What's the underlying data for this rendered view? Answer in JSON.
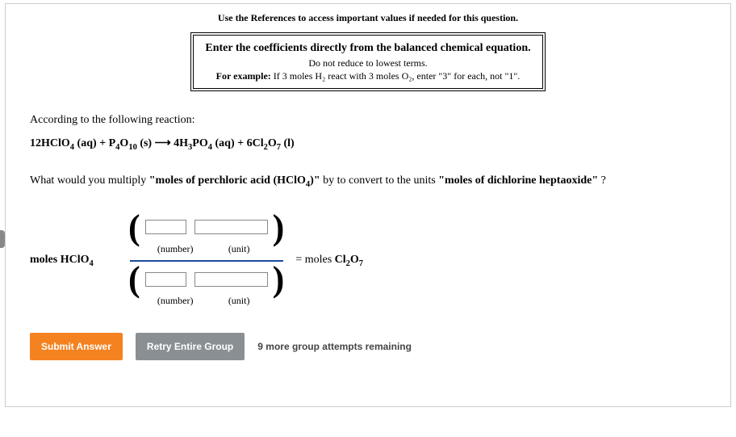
{
  "header": {
    "references_note": "Use the References to access important values if needed for this question."
  },
  "hint": {
    "line1": "Enter the coefficients directly from the balanced chemical equation.",
    "line2": "Do not reduce to lowest terms.",
    "line3_prefix": "For example:",
    "line3_rest": " If 3 moles H₂ react with 3 moles O₂, enter \"3\" for each, not \"1\"."
  },
  "intro": "According to the following reaction:",
  "equation_html": "12HClO₄ (aq) + P₄O₁₀ (s) ⟶ 4H₃PO₄ (aq) + 6Cl₂O₇ (l)",
  "question": {
    "pre": "What would you multiply ",
    "bold1": "\"moles of perchloric acid (HClO₄)\"",
    "mid": " by to convert to the units ",
    "bold2": "\"moles of dichlorine heptaoxide\"",
    "post": " ?"
  },
  "frac": {
    "lhs": "moles HClO₄",
    "rhs_prefix": "= moles ",
    "rhs_formula": "Cl₂O₇",
    "number_label": "(number)",
    "unit_label": "(unit)",
    "top": {
      "number": "",
      "unit": ""
    },
    "bottom": {
      "number": "",
      "unit": ""
    }
  },
  "buttons": {
    "submit": "Submit Answer",
    "retry": "Retry Entire Group",
    "attempts_note": "9 more group attempts remaining"
  }
}
